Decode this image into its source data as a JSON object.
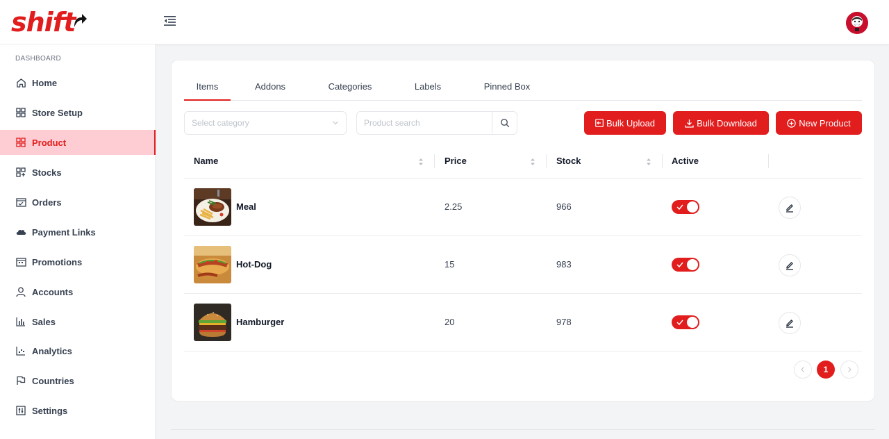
{
  "brand": {
    "logo_text": "shift",
    "accent": "#e11d1d"
  },
  "sidebar": {
    "heading": "DASHBOARD",
    "items": [
      {
        "label": "Home",
        "icon": "home-icon"
      },
      {
        "label": "Store Setup",
        "icon": "grid-icon"
      },
      {
        "label": "Product",
        "icon": "grid-icon",
        "active": true
      },
      {
        "label": "Stocks",
        "icon": "grid-plus-icon"
      },
      {
        "label": "Orders",
        "icon": "calendar-check-icon"
      },
      {
        "label": "Payment Links",
        "icon": "cloud-icon"
      },
      {
        "label": "Promotions",
        "icon": "calendar-icon"
      },
      {
        "label": "Accounts",
        "icon": "user-icon"
      },
      {
        "label": "Sales",
        "icon": "bar-chart-icon"
      },
      {
        "label": "Analytics",
        "icon": "dot-chart-icon"
      },
      {
        "label": "Countries",
        "icon": "flag-icon"
      },
      {
        "label": "Settings",
        "icon": "sliders-icon"
      }
    ]
  },
  "tabs": [
    {
      "label": "Items",
      "active": true
    },
    {
      "label": "Addons"
    },
    {
      "label": "Categories"
    },
    {
      "label": "Labels"
    },
    {
      "label": "Pinned Box"
    }
  ],
  "filters": {
    "category_placeholder": "Select category",
    "search_placeholder": "Product search"
  },
  "actions": {
    "bulk_upload": "Bulk Upload",
    "bulk_download": "Bulk Download",
    "new_product": "New Product"
  },
  "table": {
    "columns": [
      "Name",
      "Price",
      "Stock",
      "Active"
    ],
    "rows": [
      {
        "name": "Meal",
        "price": "2.25",
        "stock": "966",
        "active": true
      },
      {
        "name": "Hot-Dog",
        "price": "15",
        "stock": "983",
        "active": true
      },
      {
        "name": "Hamburger",
        "price": "20",
        "stock": "978",
        "active": true
      }
    ]
  },
  "pagination": {
    "current": "1"
  }
}
